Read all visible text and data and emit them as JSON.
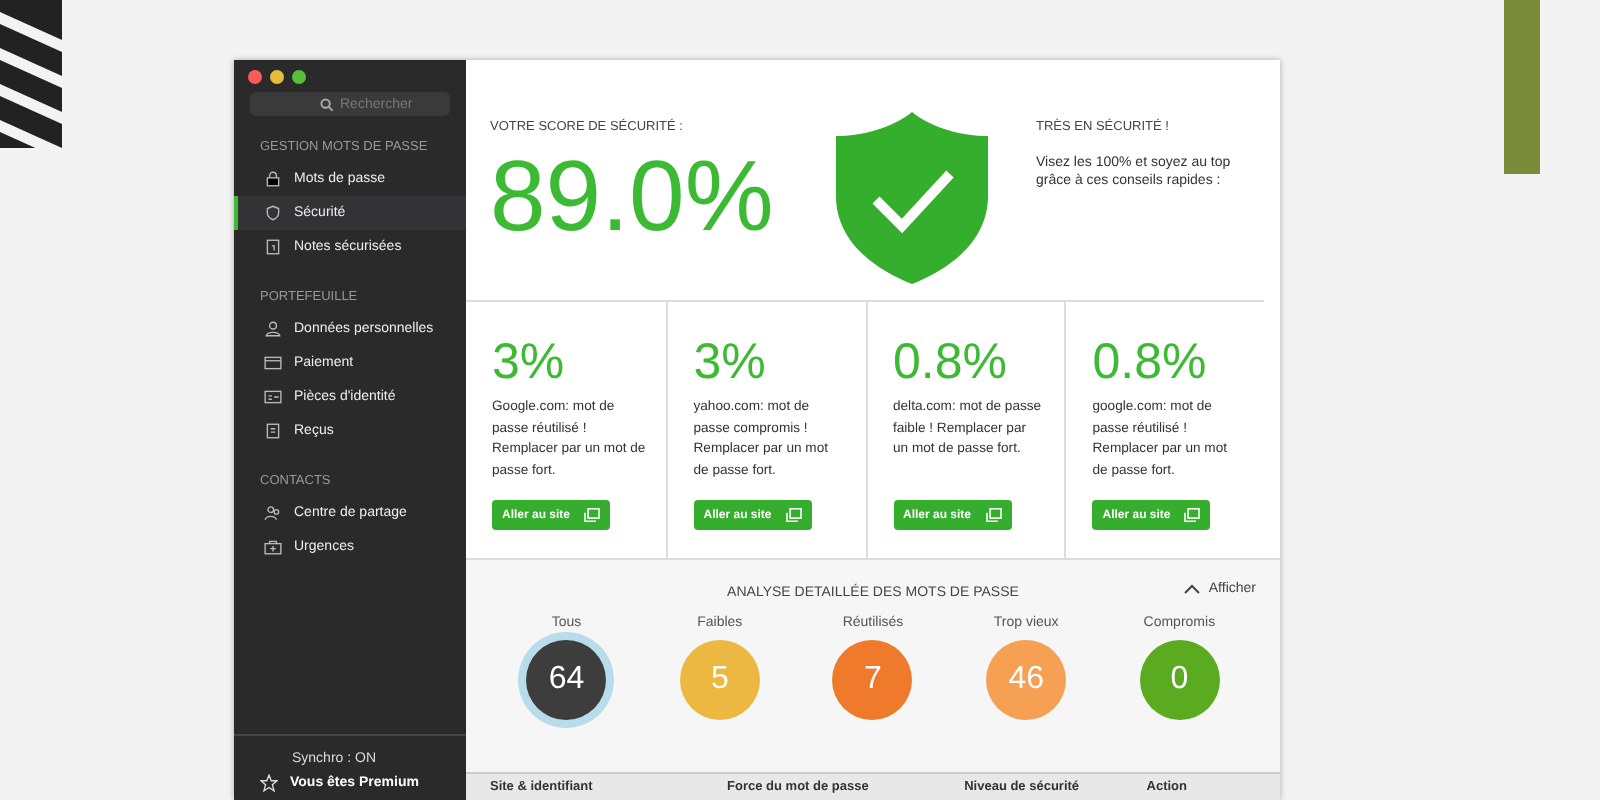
{
  "sidebar": {
    "search": {
      "placeholder": "Rechercher"
    },
    "sections": [
      {
        "title": "GESTION MOTS DE PASSE",
        "items": [
          {
            "label": "Mots de passe",
            "selected": false
          },
          {
            "label": "Sécurité",
            "selected": true
          },
          {
            "label": "Notes sécurisées",
            "selected": false
          }
        ]
      },
      {
        "title": "PORTEFEUILLE",
        "items": [
          {
            "label": "Données personnelles",
            "selected": false
          },
          {
            "label": "Paiement",
            "selected": false
          },
          {
            "label": "Pièces d'identité",
            "selected": false
          },
          {
            "label": "Reçus",
            "selected": false
          }
        ]
      },
      {
        "title": "CONTACTS",
        "items": [
          {
            "label": "Centre de partage",
            "selected": false
          },
          {
            "label": "Urgences",
            "selected": false
          }
        ]
      }
    ],
    "sync": "Synchro : ON",
    "premium": "Vous êtes Premium"
  },
  "score": {
    "label": "VOTRE SCORE DE SÉCURITÉ :",
    "value": "89.0%",
    "status": "TRÈS EN SÉCURITÉ !",
    "advice": "Visez les 100% et soyez au top grâce à ces conseils rapides :"
  },
  "tips": [
    {
      "value": "3%",
      "text": "Google.com: mot de passe réutilisé ! Remplacer par un mot de passe fort.",
      "button": "Aller au site"
    },
    {
      "value": "3%",
      "text": "yahoo.com: mot de passe compromis ! Remplacer par un mot de passe fort.",
      "button": "Aller au site"
    },
    {
      "value": "0.8%",
      "text": "delta.com: mot de passe faible ! Remplacer par un mot de passe fort.",
      "button": "Aller au site"
    },
    {
      "value": "0.8%",
      "text": "google.com: mot de passe réutilisé ! Remplacer par un mot de passe fort.",
      "button": "Aller au site"
    }
  ],
  "analysis": {
    "title": "ANALYSE DETAILLÉE DES MOTS DE PASSE",
    "toggle": "Afficher",
    "categories": [
      {
        "label": "Tous",
        "count": "64",
        "color": "#3d3d3d",
        "selected": true
      },
      {
        "label": "Faibles",
        "count": "5",
        "color": "#ecb841",
        "selected": false
      },
      {
        "label": "Réutilisés",
        "count": "7",
        "color": "#ef7a2c",
        "selected": false
      },
      {
        "label": "Trop vieux",
        "count": "46",
        "color": "#f5a053",
        "selected": false
      },
      {
        "label": "Compromis",
        "count": "0",
        "color": "#5aab1f",
        "selected": false
      }
    ]
  },
  "table": {
    "columns": [
      "Site & identifiant",
      "Force du mot de passe",
      "Niveau de sécurité",
      "Action"
    ]
  }
}
